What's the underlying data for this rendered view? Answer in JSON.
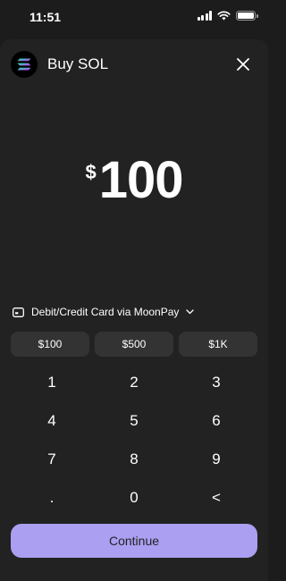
{
  "status_bar": {
    "time": "11:51"
  },
  "header": {
    "title": "Buy SOL",
    "logo_icon": "solana-logo-icon",
    "close_icon": "close-icon"
  },
  "amount": {
    "currency": "$",
    "value": "100"
  },
  "payment_method": {
    "label": "Debit/Credit Card via MoonPay",
    "icon": "card-icon",
    "chevron": "chevron-down-icon"
  },
  "presets": [
    {
      "label": "$100"
    },
    {
      "label": "$500"
    },
    {
      "label": "$1K"
    }
  ],
  "keypad": {
    "keys": [
      {
        "label": "1"
      },
      {
        "label": "2"
      },
      {
        "label": "3"
      },
      {
        "label": "4"
      },
      {
        "label": "5"
      },
      {
        "label": "6"
      },
      {
        "label": "7"
      },
      {
        "label": "8"
      },
      {
        "label": "9"
      },
      {
        "label": "."
      },
      {
        "label": "0"
      },
      {
        "label": "<"
      }
    ]
  },
  "continue_button": {
    "label": "Continue"
  },
  "colors": {
    "background": "#1c1c1c",
    "sheet": "#222222",
    "preset_bg": "#333333",
    "accent": "#ab9ff2"
  }
}
